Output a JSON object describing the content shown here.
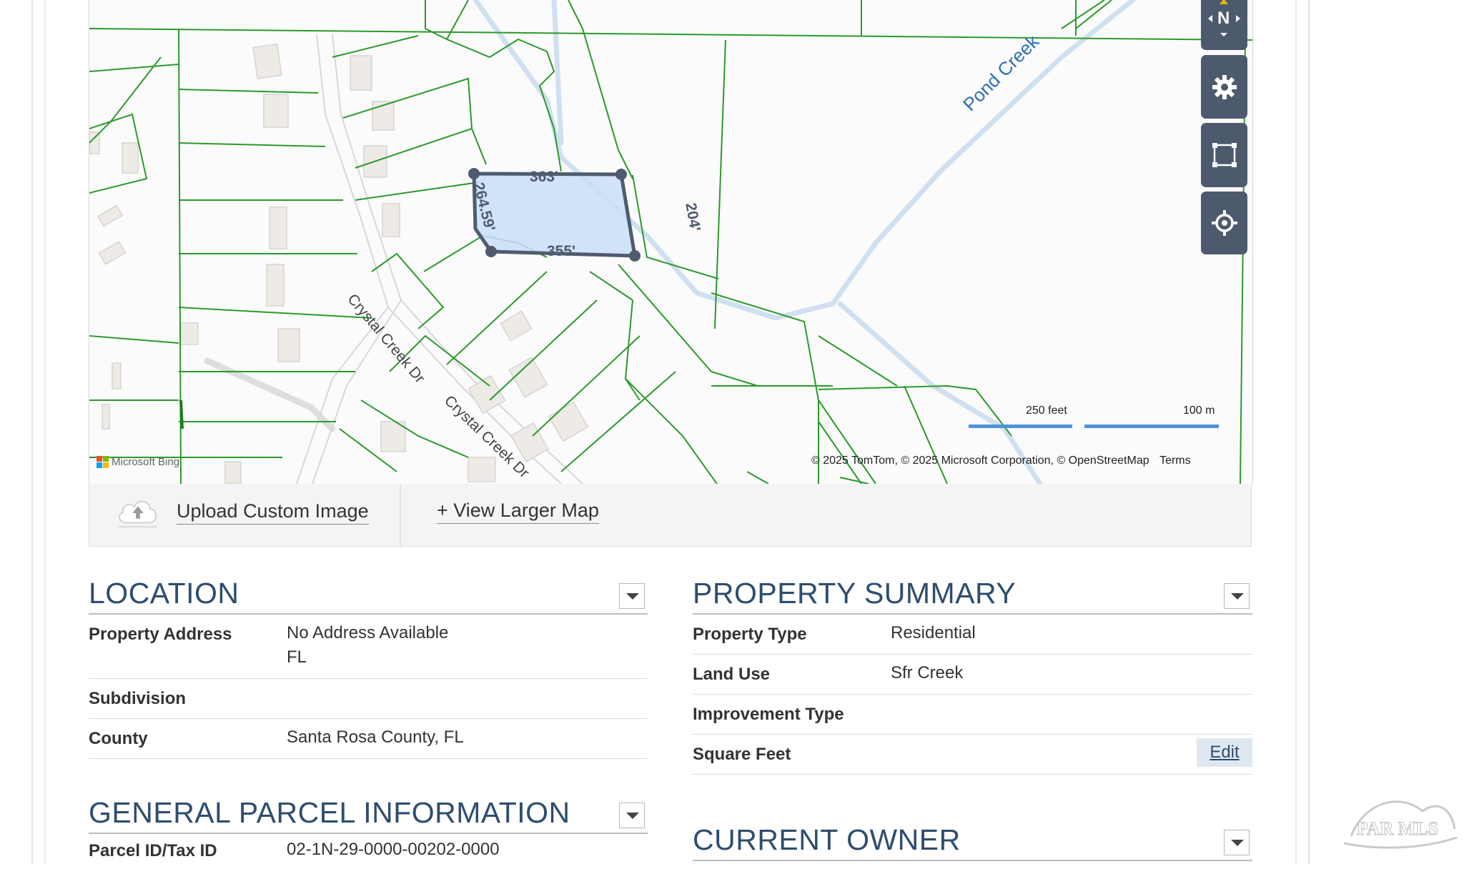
{
  "map": {
    "parcel_dims": {
      "top": "363'",
      "right": "204'",
      "bottom": "355'",
      "left": "264.59'"
    },
    "street_labels": [
      "Crystal Creek Dr",
      "Crystal Creek Dr"
    ],
    "water_label": "Pond Creek",
    "compass_label": "N",
    "scale": {
      "feet": "250 feet",
      "meters": "100 m"
    },
    "attribution": "© 2025 TomTom, © 2025 Microsoft Corporation, © OpenStreetMap",
    "terms": "Terms",
    "bing_logo": "Microsoft Bing",
    "controls": [
      "compass-icon",
      "gear-icon",
      "box-select-icon",
      "crosshair-icon"
    ]
  },
  "map_footer": {
    "upload_label": "Upload Custom Image",
    "view_larger_label": "+ View Larger Map"
  },
  "location": {
    "title": "LOCATION",
    "rows": [
      {
        "label": "Property Address",
        "value": "No Address Available",
        "value2": "FL"
      },
      {
        "label": "Subdivision",
        "value": ""
      },
      {
        "label": "County",
        "value": "Santa Rosa County, FL"
      }
    ]
  },
  "general_parcel": {
    "title": "GENERAL PARCEL INFORMATION",
    "rows": [
      {
        "label": "Parcel ID/Tax ID",
        "value": "02-1N-29-0000-00202-0000"
      }
    ]
  },
  "property_summary": {
    "title": "PROPERTY SUMMARY",
    "rows": [
      {
        "label": "Property Type",
        "value": "Residential"
      },
      {
        "label": "Land Use",
        "value": "Sfr Creek"
      },
      {
        "label": "Improvement Type",
        "value": ""
      },
      {
        "label": "Square Feet",
        "value": "",
        "action": "Edit"
      }
    ]
  },
  "current_owner": {
    "title": "CURRENT OWNER"
  },
  "watermark": "PAR MLS",
  "colors": {
    "heading": "#2e4d6f",
    "parcel_line": "#1f8a1f",
    "parcel_fill": "#c9def7",
    "control_bg": "#4d5a6e",
    "scale_bar": "#4f93d6"
  }
}
